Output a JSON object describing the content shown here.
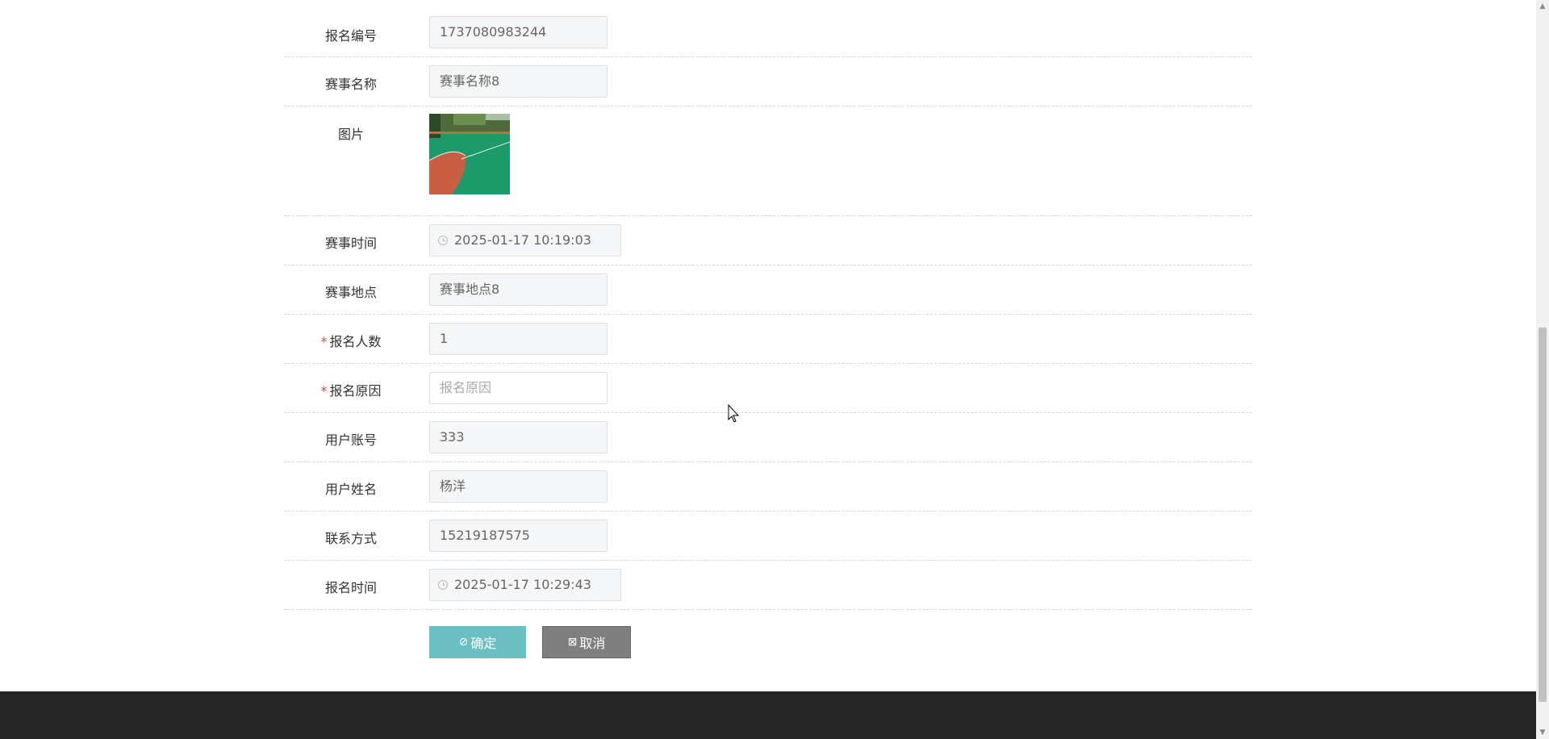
{
  "form": {
    "fields": [
      {
        "label": "报名编号",
        "value": "1737080983244",
        "required": false,
        "type": "text"
      },
      {
        "label": "赛事名称",
        "value": "赛事名称8",
        "required": false,
        "type": "text"
      },
      {
        "label": "图片",
        "type": "image"
      },
      {
        "label": "赛事时间",
        "value": "2025-01-17 10:19:03",
        "required": false,
        "type": "datetime"
      },
      {
        "label": "赛事地点",
        "value": "赛事地点8",
        "required": false,
        "type": "text"
      },
      {
        "label": "报名人数",
        "value": "1",
        "required": true,
        "type": "text"
      },
      {
        "label": "报名原因",
        "placeholder": "报名原因",
        "required": true,
        "type": "input"
      },
      {
        "label": "用户账号",
        "value": "333",
        "required": false,
        "type": "text"
      },
      {
        "label": "用户姓名",
        "value": "杨洋",
        "required": false,
        "type": "text"
      },
      {
        "label": "联系方式",
        "value": "15219187575",
        "required": false,
        "type": "text"
      },
      {
        "label": "报名时间",
        "value": "2025-01-17 10:29:43",
        "required": false,
        "type": "datetime"
      }
    ],
    "required_mark": "*"
  },
  "actions": {
    "confirm_label": "确定",
    "cancel_label": "取消"
  },
  "icons": {
    "confirm": "check-circle-icon",
    "cancel": "close-square-icon",
    "datetime": "clock-icon"
  },
  "colors": {
    "confirm_button": "#6bbfc3",
    "cancel_button": "#7f7f7f",
    "required_mark": "#e8473b",
    "footer": "#262626"
  }
}
